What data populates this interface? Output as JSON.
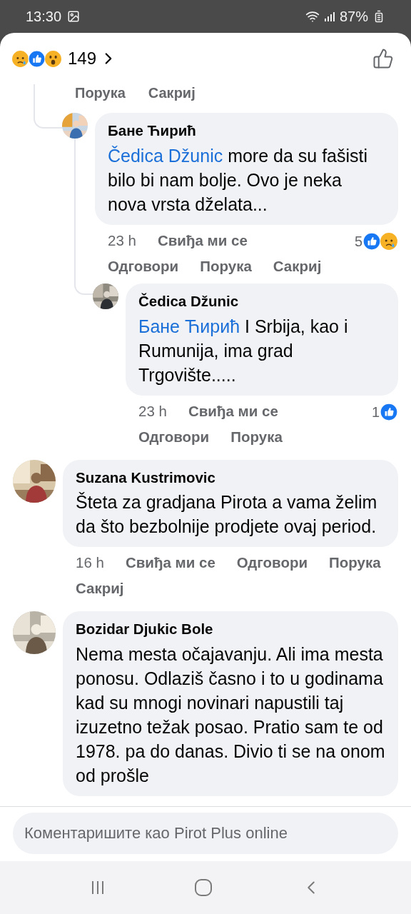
{
  "status_bar": {
    "time": "13:30",
    "battery": "87%"
  },
  "reactions_header": {
    "reactions": [
      {
        "kind": "sad"
      },
      {
        "kind": "like"
      },
      {
        "kind": "wow"
      }
    ],
    "count": "149"
  },
  "thread": {
    "cut_actions": [
      "Порука",
      "Сакриј"
    ],
    "replies": [
      {
        "author": "Бане Ћирић",
        "avatar": {
          "kind": "picture"
        },
        "mention": "Čedica Džunic",
        "text": "more da su fašisti bilo bi nam bolje. Ovo je neka nova vrsta dželata...",
        "time": "23 h",
        "actions": [
          "Свиђа ми се",
          "Одговори",
          "Порука",
          "Сакриј"
        ],
        "reaction_count": "5",
        "reactions": [
          {
            "kind": "like"
          },
          {
            "kind": "sad"
          }
        ],
        "children": [
          {
            "author": "Čedica Džunic",
            "avatar": {
              "kind": "picture"
            },
            "mention": "Бане Ћирић",
            "text": "I Srbija, kao i Rumunija, ima grad Trgovište.....",
            "time": "23 h",
            "actions": [
              "Свиђа ми се",
              "Одговори",
              "Порука"
            ],
            "reaction_count": "1",
            "reactions": [
              {
                "kind": "like"
              }
            ]
          }
        ]
      }
    ]
  },
  "comments": [
    {
      "author": "Suzana Kustrimovic",
      "avatar": {
        "kind": "picture"
      },
      "text": "Šteta za gradjana Pirota a vama želim da što bezbolnije prodjete ovaj period.",
      "time": "16 h",
      "actions": [
        "Свиђа ми се",
        "Одговори",
        "Порука",
        "Сакриј"
      ]
    },
    {
      "author": "Bozidar Djukic Bole",
      "avatar": {
        "kind": "picture"
      },
      "text": "Nema mesta očajavanju. Ali ima mesta ponosu. Odlaziš časno i to u godinama kad su mnogi novinari napustili taj izuzetno težak posao. Pratio sam te od 1978. pa do danas. Divio ti se na onom od prošle"
    }
  ],
  "composer": {
    "placeholder": "Коментаришите као Pirot Plus online"
  }
}
